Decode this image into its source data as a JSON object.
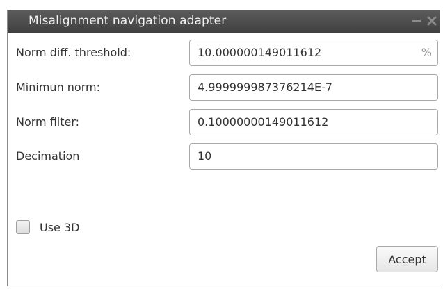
{
  "window": {
    "title": "Misalignment navigation adapter",
    "controls": [
      "minimize-icon",
      "close-icon"
    ]
  },
  "form": {
    "rows": [
      {
        "label": "Norm diff. threshold:",
        "value": "10.000000149011612",
        "unit": "%"
      },
      {
        "label": "Minimun norm:",
        "value": "4.999999987376214E-7"
      },
      {
        "label": "Norm filter:",
        "value": "0.10000000149011612"
      },
      {
        "label": "Decimation",
        "value": "10"
      }
    ],
    "use3d": {
      "label": "Use 3D",
      "checked": false
    }
  },
  "actions": {
    "accept_label": "Accept"
  }
}
